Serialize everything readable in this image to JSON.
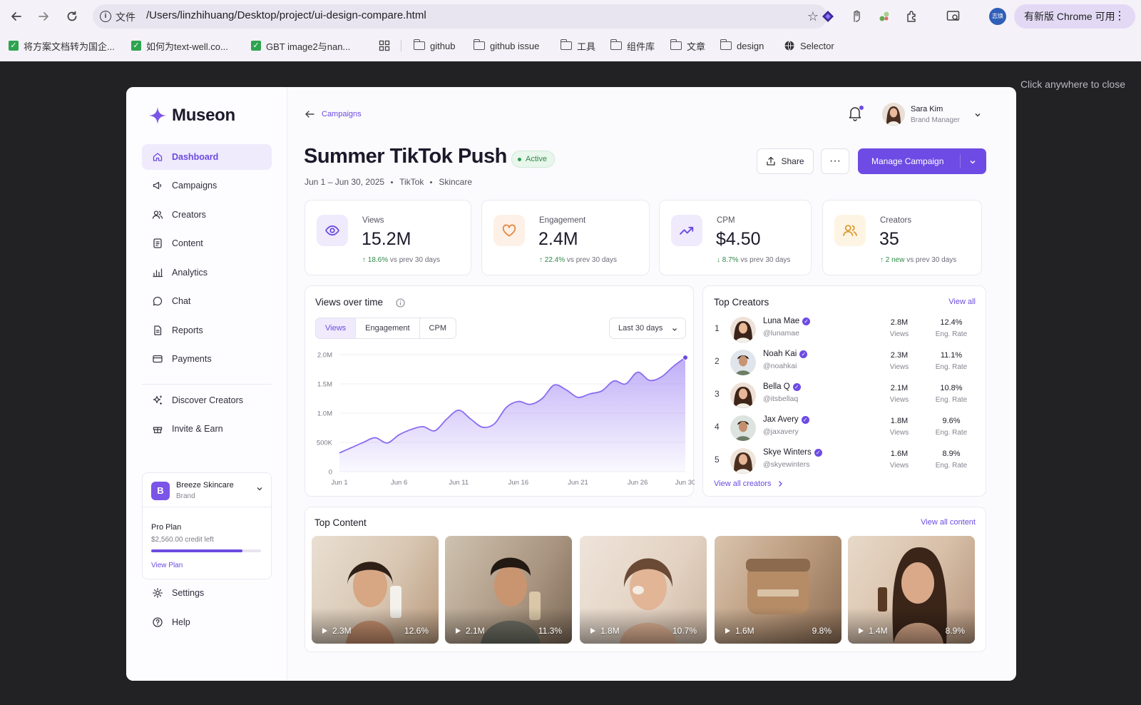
{
  "browser": {
    "scheme_label": "文件",
    "url": "/Users/linzhihuang/Desktop/project/ui-design-compare.html",
    "profile_initials": "志焕",
    "update_label": "有新版 Chrome 可用",
    "bookmarks": [
      {
        "label": "将方案文档转为国企...",
        "kind": "check"
      },
      {
        "label": "如何为text-well.co...",
        "kind": "check"
      },
      {
        "label": "GBT image2与nan...",
        "kind": "check"
      },
      {
        "label": "github",
        "kind": "folder"
      },
      {
        "label": "github issue",
        "kind": "folder"
      },
      {
        "label": "工具",
        "kind": "folder"
      },
      {
        "label": "组件库",
        "kind": "folder"
      },
      {
        "label": "文章",
        "kind": "folder"
      },
      {
        "label": "design",
        "kind": "folder"
      },
      {
        "label": "Selector",
        "kind": "globe"
      }
    ]
  },
  "overlay": {
    "close_hint": "Click anywhere to close"
  },
  "sidebar": {
    "logo": "Museon",
    "items": [
      {
        "label": "Dashboard",
        "icon": "home-icon",
        "active": true
      },
      {
        "label": "Campaigns",
        "icon": "megaphone-icon"
      },
      {
        "label": "Creators",
        "icon": "users-icon"
      },
      {
        "label": "Content",
        "icon": "document-icon"
      },
      {
        "label": "Analytics",
        "icon": "bar-chart-icon"
      },
      {
        "label": "Chat",
        "icon": "chat-icon"
      },
      {
        "label": "Reports",
        "icon": "report-icon"
      },
      {
        "label": "Payments",
        "icon": "card-icon"
      },
      {
        "label": "Discover Creators",
        "icon": "sparkle-icon"
      },
      {
        "label": "Invite & Earn",
        "icon": "gift-icon"
      },
      {
        "label": "Settings",
        "icon": "gear-icon"
      },
      {
        "label": "Help",
        "icon": "help-icon"
      }
    ],
    "brand": {
      "initial": "B",
      "name": "Breeze Skincare",
      "type": "Brand"
    },
    "plan": {
      "name": "Pro Plan",
      "credit": "$2,560.00 credit left",
      "usage_fraction": 0.83,
      "link": "View Plan"
    }
  },
  "header": {
    "breadcrumb": "Campaigns",
    "user": {
      "name": "Sara Kim",
      "role": "Brand Manager"
    }
  },
  "campaign": {
    "title": "Summer TikTok Push",
    "status": "Active",
    "dates": "Jun 1 – Jun 30, 2025",
    "platform": "TikTok",
    "category": "Skincare",
    "share_label": "Share",
    "more_label": "···",
    "manage_label": "Manage Campaign"
  },
  "kpis": [
    {
      "label": "Views",
      "value": "15.2M",
      "delta": "18.6%",
      "suffix": "vs prev 30 days",
      "dir": "up",
      "icon": "eye-icon",
      "tint": "#efeafc",
      "color": "#6b4be0"
    },
    {
      "label": "Engagement",
      "value": "2.4M",
      "delta": "22.4%",
      "suffix": "vs prev 30 days",
      "dir": "up",
      "icon": "heart-icon",
      "tint": "#fdf0e7",
      "color": "#e4873f"
    },
    {
      "label": "CPM",
      "value": "$4.50",
      "delta": "8.7%",
      "suffix": "vs prev 30 days",
      "dir": "down",
      "icon": "trend-icon",
      "tint": "#efeafc",
      "color": "#6b4be0"
    },
    {
      "label": "Creators",
      "value": "35",
      "delta": "2 new",
      "suffix": "vs prev 30 days",
      "dir": "up",
      "icon": "users-icon",
      "tint": "#fdf4e3",
      "color": "#d99a2e"
    }
  ],
  "views_card": {
    "title": "Views over time",
    "tabs": [
      "Views",
      "Engagement",
      "CPM"
    ],
    "active_tab": "Views",
    "range": "Last 30 days"
  },
  "chart_data": {
    "type": "area",
    "title": "Views over time",
    "xlabel": "",
    "ylabel": "",
    "x_ticks": [
      "Jun 1",
      "Jun 6",
      "Jun 11",
      "Jun 16",
      "Jun 21",
      "Jun 26",
      "Jun 30"
    ],
    "y_ticks": [
      "0",
      "500K",
      "1.0M",
      "1.5M",
      "2.0M"
    ],
    "ylim": [
      0,
      2000000
    ],
    "x": [
      1,
      2,
      3,
      4,
      5,
      6,
      7,
      8,
      9,
      10,
      11,
      12,
      13,
      14,
      15,
      16,
      17,
      18,
      19,
      20,
      21,
      22,
      23,
      24,
      25,
      26,
      27,
      28,
      29,
      30
    ],
    "values": [
      320000,
      410000,
      500000,
      580000,
      490000,
      630000,
      720000,
      770000,
      700000,
      900000,
      1050000,
      900000,
      760000,
      820000,
      1100000,
      1200000,
      1150000,
      1250000,
      1480000,
      1400000,
      1270000,
      1330000,
      1380000,
      1550000,
      1500000,
      1700000,
      1560000,
      1620000,
      1800000,
      1950000
    ],
    "grid": true,
    "series_color": "#8b6cf0"
  },
  "top_creators": {
    "title": "Top Creators",
    "view_all": "View all",
    "footer_link": "View all creators",
    "views_label": "Views",
    "rate_label": "Eng. Rate",
    "rows": [
      {
        "rank": "1",
        "name": "Luna Mae",
        "handle": "@lunamae",
        "views": "2.8M",
        "rate": "12.4%"
      },
      {
        "rank": "2",
        "name": "Noah Kai",
        "handle": "@noahkai",
        "views": "2.3M",
        "rate": "11.1%"
      },
      {
        "rank": "3",
        "name": "Bella Q",
        "handle": "@itsbellaq",
        "views": "2.1M",
        "rate": "10.8%"
      },
      {
        "rank": "4",
        "name": "Jax Avery",
        "handle": "@jaxavery",
        "views": "1.8M",
        "rate": "9.6%"
      },
      {
        "rank": "5",
        "name": "Skye Winters",
        "handle": "@skyewinters",
        "views": "1.6M",
        "rate": "8.9%"
      }
    ]
  },
  "top_content": {
    "title": "Top Content",
    "view_all": "View all content",
    "items": [
      {
        "views": "2.3M",
        "rate": "12.6%"
      },
      {
        "views": "2.1M",
        "rate": "11.3%"
      },
      {
        "views": "1.8M",
        "rate": "10.7%"
      },
      {
        "views": "1.6M",
        "rate": "9.8%"
      },
      {
        "views": "1.4M",
        "rate": "8.9%"
      }
    ]
  }
}
